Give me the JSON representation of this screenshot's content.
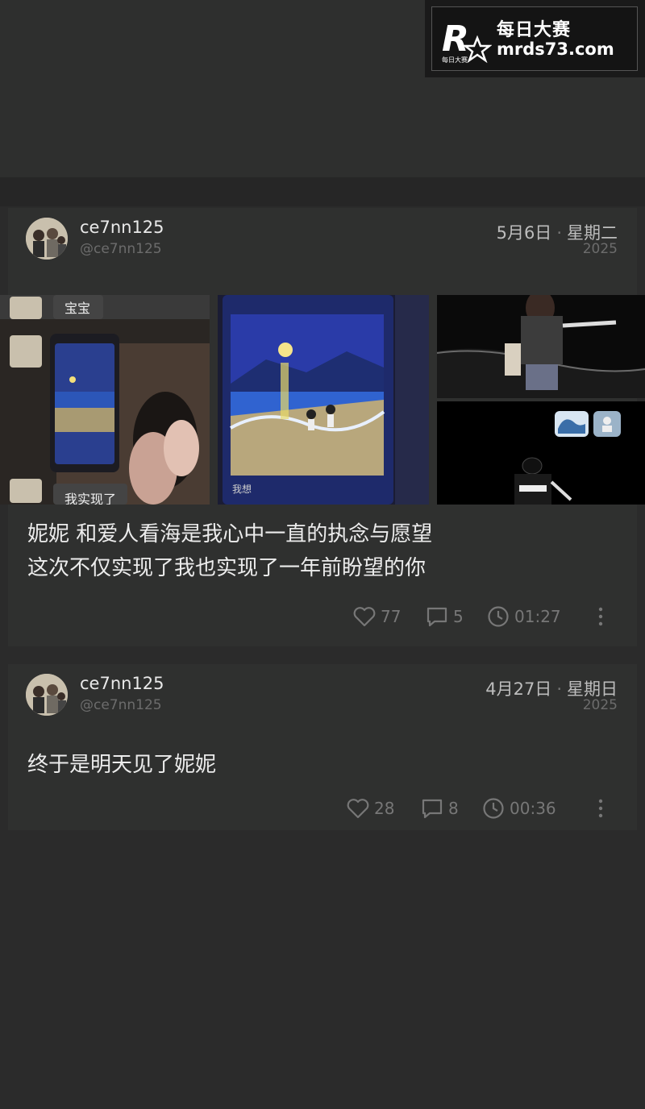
{
  "watermark": {
    "brand_cn": "每日大赛",
    "url": "mrds73.com",
    "logo_letter": "R",
    "logo_small": "每日大赛"
  },
  "posts": [
    {
      "username": "ce7nn125",
      "handle": "@ce7nn125",
      "date": "5月6日",
      "weekday": "星期二",
      "year": "2025",
      "image_labels": {
        "bubble_1": "宝宝",
        "bubble_2": "我实现了",
        "phone_caption": "我想"
      },
      "text_lines": [
        "妮妮 和爱人看海是我心中一直的执念与愿望",
        "这次不仅实现了我也实现了一年前盼望的你"
      ],
      "likes": "77",
      "comments": "5",
      "time": "01:27"
    },
    {
      "username": "ce7nn125",
      "handle": "@ce7nn125",
      "date": "4月27日",
      "weekday": "星期日",
      "year": "2025",
      "text_lines": [
        "终于是明天见了妮妮"
      ],
      "likes": "28",
      "comments": "8",
      "time": "00:36"
    }
  ],
  "colors": {
    "background": "#2b2b2b",
    "card": "#2f302f",
    "text": "#ececec",
    "muted": "#6c6c6c"
  }
}
